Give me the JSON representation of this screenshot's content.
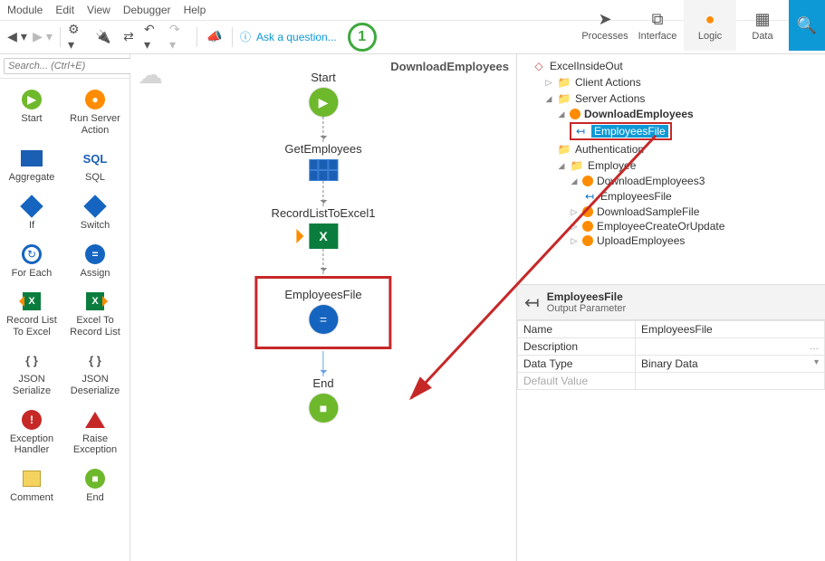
{
  "menu": {
    "items": [
      "Module",
      "Edit",
      "View",
      "Debugger",
      "Help"
    ]
  },
  "toolbar": {
    "ask": "Ask a question...",
    "badge": "1"
  },
  "toptabs": {
    "processes": "Processes",
    "interface": "Interface",
    "logic": "Logic",
    "data": "Data"
  },
  "toolbox": {
    "search_placeholder": "Search... (Ctrl+E)",
    "items": [
      {
        "label": "Start",
        "icon": "▶",
        "shape": "circle",
        "bg": "#6eb82c"
      },
      {
        "label": "Run Server Action",
        "icon": "●",
        "shape": "circle",
        "bg": "#ff8c00"
      },
      {
        "label": "Aggregate",
        "icon": "▦",
        "shape": "rect",
        "bg": "#1a5fb4"
      },
      {
        "label": "SQL",
        "icon": "SQL",
        "shape": "text",
        "bg": "#1a5fb4"
      },
      {
        "label": "If",
        "icon": "◆",
        "shape": "diamond",
        "bg": "#1565c0"
      },
      {
        "label": "Switch",
        "icon": "◆",
        "shape": "diamond",
        "bg": "#1565c0"
      },
      {
        "label": "For Each",
        "icon": "↻",
        "shape": "circle-o",
        "bg": "#1565c0"
      },
      {
        "label": "Assign",
        "icon": "=",
        "shape": "circle",
        "bg": "#1565c0"
      },
      {
        "label": "Record List To Excel",
        "icon": "X",
        "shape": "excel-out",
        "bg": "#0a7d3e"
      },
      {
        "label": "Excel To Record List",
        "icon": "X",
        "shape": "excel-in",
        "bg": "#0a7d3e"
      },
      {
        "label": "JSON Serialize",
        "icon": "{ }",
        "shape": "text",
        "bg": "#555"
      },
      {
        "label": "JSON Deserialize",
        "icon": "{ }",
        "shape": "text",
        "bg": "#555"
      },
      {
        "label": "Exception Handler",
        "icon": "!",
        "shape": "circle",
        "bg": "#c62828"
      },
      {
        "label": "Raise Exception",
        "icon": "▲",
        "shape": "triangle",
        "bg": "#c62828"
      },
      {
        "label": "Comment",
        "icon": "▭",
        "shape": "note",
        "bg": "#f4d35e"
      },
      {
        "label": "End",
        "icon": "■",
        "shape": "circle",
        "bg": "#6eb82c"
      }
    ]
  },
  "canvas": {
    "title": "DownloadEmployees",
    "nodes": {
      "start": "Start",
      "get": "GetEmployees",
      "excel": "RecordListToExcel1",
      "assign": "EmployeesFile",
      "end": "End"
    }
  },
  "tree": {
    "root": "ExcelInsideOut",
    "client": "Client Actions",
    "server": "Server Actions",
    "download": "DownloadEmployees",
    "empfile": "EmployeesFile",
    "auth": "Authentication",
    "employee": "Employee",
    "de3": "DownloadEmployees3",
    "de3_out": "EmployeesFile",
    "dsf": "DownloadSampleFile",
    "ecu": "EmployeeCreateOrUpdate",
    "ue": "UploadEmployees"
  },
  "props": {
    "title": "EmployeesFile",
    "subtitle": "Output Parameter",
    "rows": {
      "name_k": "Name",
      "name_v": "EmployeesFile",
      "desc_k": "Description",
      "desc_v": "",
      "dt_k": "Data Type",
      "dt_v": "Binary Data",
      "def_k": "Default Value",
      "def_v": ""
    }
  }
}
